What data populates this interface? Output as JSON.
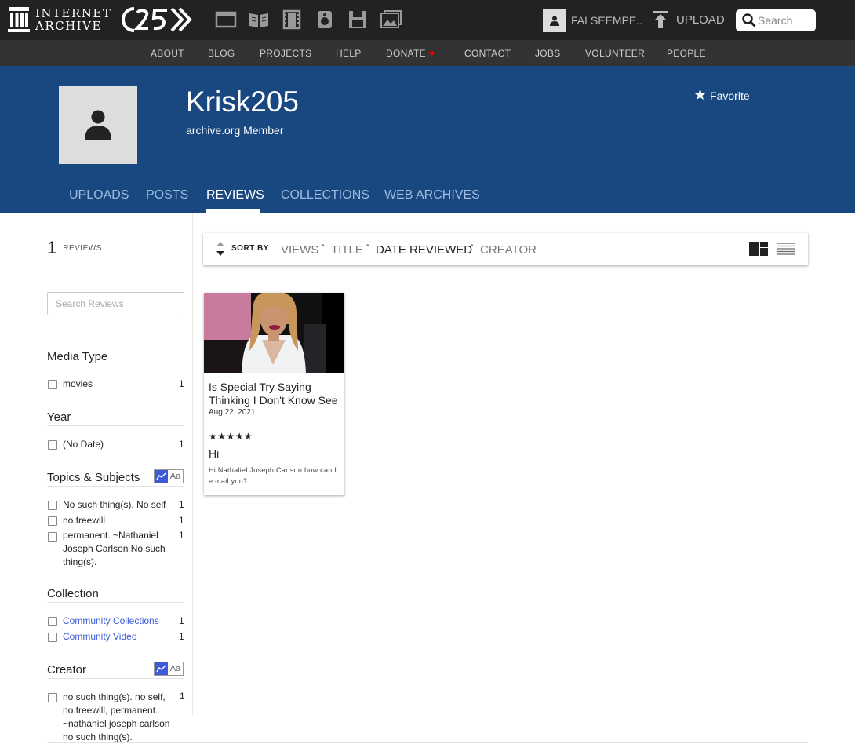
{
  "header": {
    "logo_line1": "INTERNET",
    "logo_line2": "ARCHIVE",
    "media_icons": [
      "web-icon",
      "texts-icon",
      "video-icon",
      "audio-icon",
      "software-icon",
      "images-icon"
    ],
    "account_name": "FALSEEMPE...",
    "upload_label": "UPLOAD",
    "search_placeholder": "Search"
  },
  "subnav": [
    "ABOUT",
    "BLOG",
    "PROJECTS",
    "HELP",
    "DONATE",
    "CONTACT",
    "JOBS",
    "VOLUNTEER",
    "PEOPLE"
  ],
  "profile": {
    "username": "Krisk205",
    "subtitle": "archive.org Member",
    "favorite_label": "Favorite"
  },
  "tabs": [
    "UPLOADS",
    "POSTS",
    "REVIEWS",
    "COLLECTIONS",
    "WEB ARCHIVES"
  ],
  "active_tab": "REVIEWS",
  "sidebar": {
    "count": "1",
    "count_label": "REVIEWS",
    "search_placeholder": "Search Reviews",
    "toggle_label": "Aa",
    "facets": {
      "media_type": {
        "title": "Media Type",
        "items": [
          {
            "label": "movies",
            "count": "1"
          }
        ]
      },
      "year": {
        "title": "Year",
        "items": [
          {
            "label": "(No Date)",
            "count": "1"
          }
        ]
      },
      "topics": {
        "title": "Topics & Subjects",
        "items": [
          {
            "label": "No such thing(s). No self",
            "count": "1"
          },
          {
            "label": "no freewill",
            "count": "1"
          },
          {
            "label": "permanent. ~Nathaniel Joseph Carlson No such thing(s).",
            "count": "1"
          }
        ]
      },
      "collection": {
        "title": "Collection",
        "items": [
          {
            "label": "Community Collections",
            "count": "1"
          },
          {
            "label": "Community Video",
            "count": "1"
          }
        ]
      },
      "creator": {
        "title": "Creator",
        "items": [
          {
            "label": "no such thing(s). no self, no freewill, permanent. ~nathaniel joseph carlson no such thing(s).",
            "count": "1"
          }
        ]
      }
    }
  },
  "sortbar": {
    "label": "SORT BY",
    "options": [
      "VIEWS",
      "TITLE",
      "DATE REVIEWED",
      "CREATOR"
    ],
    "active": "DATE REVIEWED"
  },
  "review_card": {
    "title": "Is Special Try Saying Thinking I Don't Know See",
    "date": "Aug 22, 2021",
    "stars": "★★★★★",
    "rating": 5,
    "review_heading": "Hi",
    "review_body": "Hi Nathaliel Joseph Carlson how can I e mail you?"
  },
  "colors": {
    "topbar": "#222222",
    "subnav": "#333333",
    "banner": "#194880",
    "link": "#3d5ad8",
    "donate_heart": "#ee0000"
  }
}
